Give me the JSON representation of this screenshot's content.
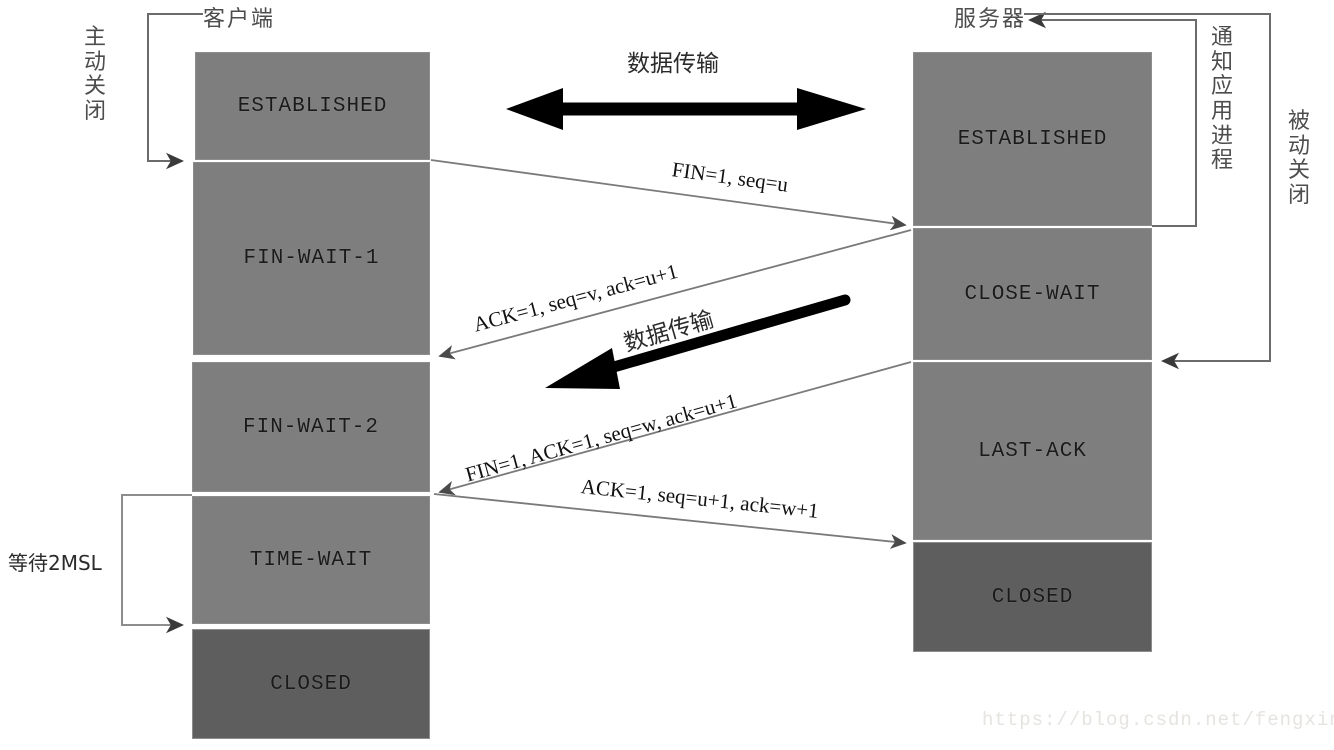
{
  "diagram": {
    "title_client": "客户端",
    "title_server": "服务器",
    "watermark": "https://blog.csdn.net/fengxinlinux"
  },
  "annotations": {
    "active_close": "主动关闭",
    "passive_close": "被动关闭",
    "notify_app": "通知应用进程",
    "wait_2msl": "等待2MSL",
    "data_transfer_top": "数据传输",
    "data_transfer_mid": "数据传输"
  },
  "client_states": [
    {
      "label": "ESTABLISHED",
      "tone": "light"
    },
    {
      "label": "FIN-WAIT-1",
      "tone": "light"
    },
    {
      "label": "FIN-WAIT-2",
      "tone": "light"
    },
    {
      "label": "TIME-WAIT",
      "tone": "light"
    },
    {
      "label": "CLOSED",
      "tone": "dark"
    }
  ],
  "server_states": [
    {
      "label": "ESTABLISHED",
      "tone": "light"
    },
    {
      "label": "CLOSE-WAIT",
      "tone": "light"
    },
    {
      "label": "LAST-ACK",
      "tone": "light"
    },
    {
      "label": "CLOSED",
      "tone": "dark"
    }
  ],
  "messages": [
    {
      "id": "fin1",
      "text": "FIN=1,  seq=u",
      "direction": "client-to-server"
    },
    {
      "id": "ack1",
      "text": "ACK=1, seq=v, ack=u+1",
      "direction": "server-to-client"
    },
    {
      "id": "fin2",
      "text": "FIN=1,  ACK=1,  seq=w, ack=u+1",
      "direction": "server-to-client"
    },
    {
      "id": "ack2",
      "text": "ACK=1, seq=u+1, ack=w+1",
      "direction": "client-to-server"
    }
  ],
  "colors": {
    "state_light": "#7e7e7e",
    "state_dark": "#5e5e5e",
    "line": "#6b6b6b",
    "bold_arrow": "#000000",
    "label_gray": "#4d4d4d",
    "watermark": "#e6e4e0"
  }
}
